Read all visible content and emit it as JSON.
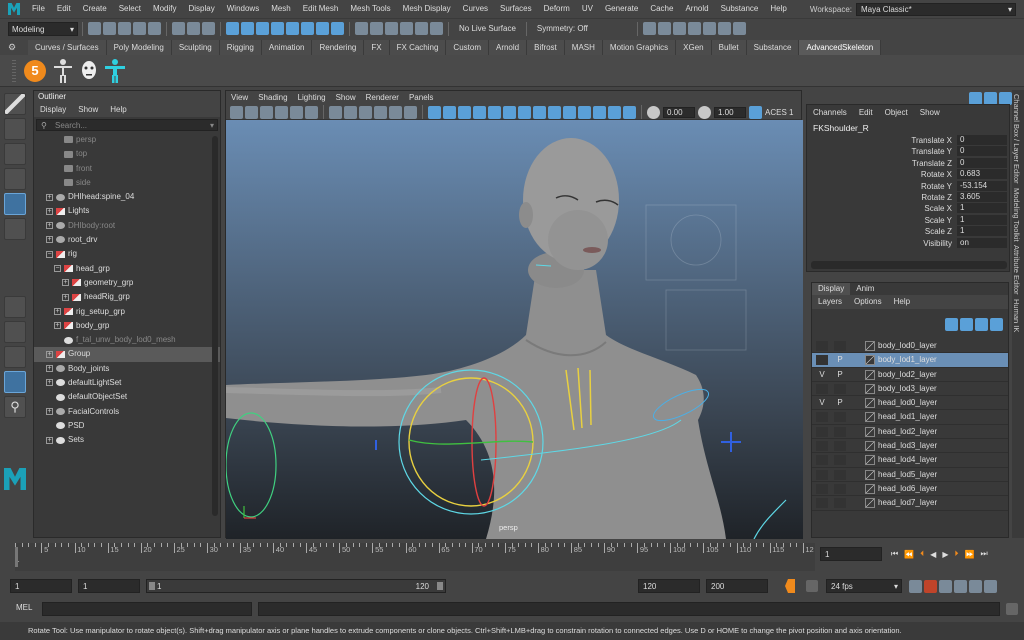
{
  "menubar": {
    "items": [
      "File",
      "Edit",
      "Create",
      "Select",
      "Modify",
      "Display",
      "Windows",
      "Mesh",
      "Edit Mesh",
      "Mesh Tools",
      "Mesh Display",
      "Curves",
      "Surfaces",
      "Deform",
      "UV",
      "Generate",
      "Cache",
      "Arnold",
      "Substance",
      "Help"
    ],
    "workspace_label": "Workspace:",
    "workspace_value": "Maya Classic*"
  },
  "statusline": {
    "mode": "Modeling",
    "live_surface": "No Live Surface",
    "symmetry": "Symmetry: Off"
  },
  "shelf": {
    "tabs": [
      "Curves / Surfaces",
      "Poly Modeling",
      "Sculpting",
      "Rigging",
      "Animation",
      "Rendering",
      "FX",
      "FX Caching",
      "Custom",
      "Arnold",
      "Bifrost",
      "MASH",
      "Motion Graphics",
      "XGen",
      "Bullet",
      "Substance",
      "AdvancedSkeleton"
    ],
    "active_tab": "AdvancedSkeleton",
    "badge_number": "5"
  },
  "outliner": {
    "title": "Outliner",
    "menu": [
      "Display",
      "Show",
      "Help"
    ],
    "search_placeholder": "Search...",
    "rows": [
      {
        "label": "persp",
        "indent": 2,
        "icon": "cam",
        "dim": true,
        "exp": false
      },
      {
        "label": "top",
        "indent": 2,
        "icon": "cam",
        "dim": true,
        "exp": false
      },
      {
        "label": "front",
        "indent": 2,
        "icon": "cam",
        "dim": true,
        "exp": false
      },
      {
        "label": "side",
        "indent": 2,
        "icon": "cam",
        "dim": true,
        "exp": false
      },
      {
        "label": "DHIhead:spine_04",
        "indent": 1,
        "icon": "jnt",
        "dim": false,
        "exp": true
      },
      {
        "label": "Lights",
        "indent": 1,
        "icon": "grp",
        "dim": false,
        "exp": true
      },
      {
        "label": "DHIbody:root",
        "indent": 1,
        "icon": "jnt",
        "dim": true,
        "exp": true
      },
      {
        "label": "root_drv",
        "indent": 1,
        "icon": "jnt",
        "dim": false,
        "exp": true
      },
      {
        "label": "rig",
        "indent": 1,
        "icon": "grp",
        "dim": false,
        "exp": "-"
      },
      {
        "label": "head_grp",
        "indent": 2,
        "icon": "grp",
        "dim": false,
        "exp": "-"
      },
      {
        "label": "geometry_grp",
        "indent": 3,
        "icon": "grp",
        "dim": false,
        "exp": true
      },
      {
        "label": "headRig_grp",
        "indent": 3,
        "icon": "grp",
        "dim": false,
        "exp": true
      },
      {
        "label": "rig_setup_grp",
        "indent": 2,
        "icon": "grp",
        "dim": false,
        "exp": true
      },
      {
        "label": "body_grp",
        "indent": 2,
        "icon": "grp",
        "dim": false,
        "exp": true
      },
      {
        "label": "f_tal_unw_body_lod0_mesh",
        "indent": 2,
        "icon": "mesh",
        "dim": true,
        "exp": false
      },
      {
        "label": "Group",
        "indent": 1,
        "icon": "grp",
        "dim": false,
        "exp": true,
        "sel": true
      },
      {
        "label": "Body_joints",
        "indent": 1,
        "icon": "jnt",
        "dim": false,
        "exp": true
      },
      {
        "label": "defaultLightSet",
        "indent": 1,
        "icon": "set",
        "dim": false,
        "exp": true
      },
      {
        "label": "defaultObjectSet",
        "indent": 1,
        "icon": "set",
        "dim": false,
        "exp": false
      },
      {
        "label": "FacialControls",
        "indent": 1,
        "icon": "jnt",
        "dim": false,
        "exp": true
      },
      {
        "label": "PSD",
        "indent": 1,
        "icon": "set",
        "dim": false,
        "exp": false
      },
      {
        "label": "Sets",
        "indent": 1,
        "icon": "set",
        "dim": false,
        "exp": true
      }
    ]
  },
  "viewport": {
    "menu": [
      "View",
      "Shading",
      "Lighting",
      "Show",
      "Renderer",
      "Panels"
    ],
    "field_a": "0.00",
    "field_b": "1.00",
    "color_space": "ACES 1",
    "camera_label": "persp"
  },
  "channelbox": {
    "menu": [
      "Channels",
      "Edit",
      "Object",
      "Show"
    ],
    "object": "FKShoulder_R",
    "attrs": [
      {
        "name": "Translate X",
        "value": "0"
      },
      {
        "name": "Translate Y",
        "value": "0"
      },
      {
        "name": "Translate Z",
        "value": "0"
      },
      {
        "name": "Rotate X",
        "value": "0.683"
      },
      {
        "name": "Rotate Y",
        "value": "-53.154"
      },
      {
        "name": "Rotate Z",
        "value": "3.605"
      },
      {
        "name": "Scale X",
        "value": "1"
      },
      {
        "name": "Scale Y",
        "value": "1"
      },
      {
        "name": "Scale Z",
        "value": "1"
      },
      {
        "name": "Visibility",
        "value": "on"
      }
    ]
  },
  "layers": {
    "tabs": [
      "Display",
      "Anim"
    ],
    "menu": [
      "Layers",
      "Options",
      "Help"
    ],
    "rows": [
      {
        "v": "",
        "p": "",
        "name": "body_lod0_layer",
        "sel": false
      },
      {
        "v": "",
        "p": "P",
        "name": "body_lod1_layer",
        "sel": true
      },
      {
        "v": "V",
        "p": "P",
        "name": "body_lod2_layer",
        "sel": false
      },
      {
        "v": "",
        "p": "",
        "name": "body_lod3_layer",
        "sel": false
      },
      {
        "v": "V",
        "p": "P",
        "name": "head_lod0_layer",
        "sel": false
      },
      {
        "v": "",
        "p": "",
        "name": "head_lod1_layer",
        "sel": false
      },
      {
        "v": "",
        "p": "",
        "name": "head_lod2_layer",
        "sel": false
      },
      {
        "v": "",
        "p": "",
        "name": "head_lod3_layer",
        "sel": false
      },
      {
        "v": "",
        "p": "",
        "name": "head_lod4_layer",
        "sel": false
      },
      {
        "v": "",
        "p": "",
        "name": "head_lod5_layer",
        "sel": false
      },
      {
        "v": "",
        "p": "",
        "name": "head_lod6_layer",
        "sel": false
      },
      {
        "v": "",
        "p": "",
        "name": "head_lod7_layer",
        "sel": false
      }
    ]
  },
  "sidetabs": [
    "Channel Box / Layer Editor",
    "Modeling Toolkit",
    "Attribute Editor",
    "Human IK"
  ],
  "timeslider": {
    "ticks": [
      "5",
      "10",
      "15",
      "20",
      "25",
      "30",
      "35",
      "40",
      "45",
      "50",
      "55",
      "60",
      "65",
      "70",
      "75",
      "80",
      "85",
      "90",
      "95",
      "100",
      "105",
      "110",
      "115",
      "12"
    ],
    "start_marker": "1",
    "current_frame": "1"
  },
  "range": {
    "start": "1",
    "start2": "1",
    "range_start": "1",
    "range_end": "120",
    "end": "120",
    "end2": "200",
    "fps": "24 fps"
  },
  "mel": {
    "label": "MEL"
  },
  "help": {
    "text": "Rotate Tool: Use manipulator to rotate object(s). Shift+drag manipulator axis or plane handles to extrude components or clone objects. Ctrl+Shift+LMB+drag to constrain rotation to connected edges. Use D or HOME to change the pivot position and axis orientation."
  },
  "colors": {
    "accent": "#5aa0d8",
    "selected_layer": "#6a8fb6",
    "viewport_top": "#6a8db4",
    "viewport_bottom": "#1f2328"
  }
}
